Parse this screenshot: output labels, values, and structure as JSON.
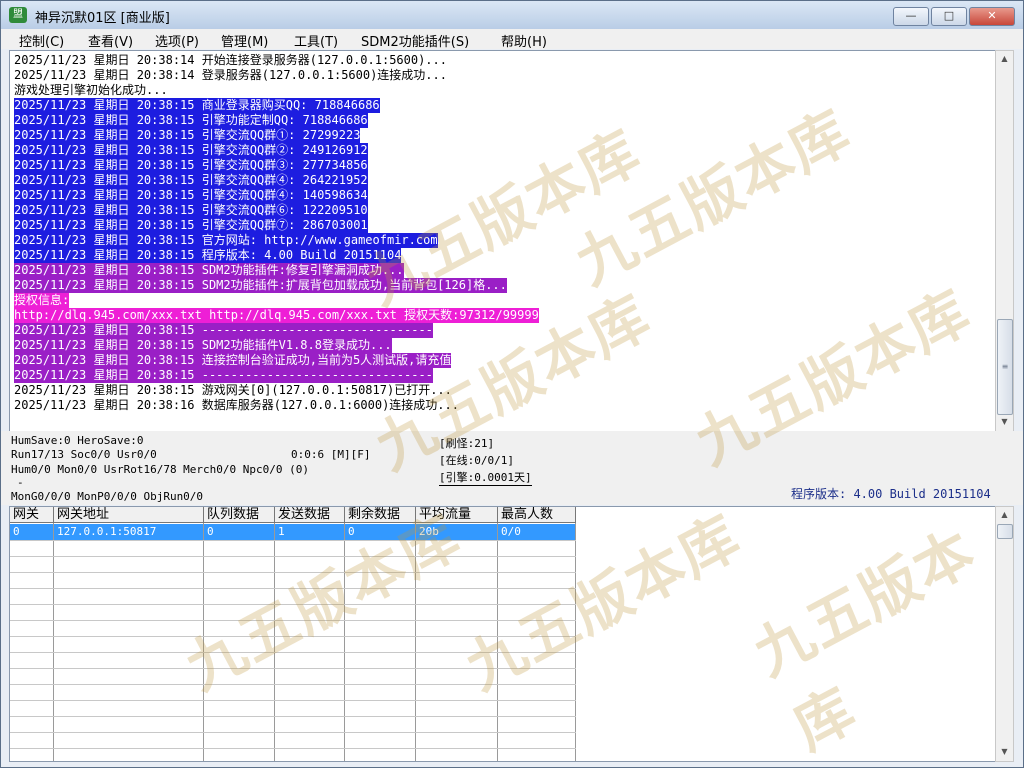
{
  "window": {
    "title": "神异沉默01区 [商业版]",
    "min": "—",
    "max": "□",
    "close": "✕",
    "icon": "app-icon"
  },
  "menu": [
    "控制(C)",
    "查看(V)",
    "选项(P)",
    "管理(M)",
    "工具(T)",
    "SDM2功能插件(S)",
    "帮助(H)"
  ],
  "log": [
    {
      "text": "2025/11/23 星期日 20:38:14 开始连接登录服务器(127.0.0.1:5600)...",
      "bg": "#ffffff",
      "fg": "#000000"
    },
    {
      "text": "2025/11/23 星期日 20:38:14 登录服务器(127.0.0.1:5600)连接成功...",
      "bg": "#ffffff",
      "fg": "#000000"
    },
    {
      "text": "游戏处理引擎初始化成功...",
      "bg": "#ffffff",
      "fg": "#000000"
    },
    {
      "text": "2025/11/23 星期日 20:38:15 商业登录器购买QQ: 718846686",
      "bg": "#1d1de0",
      "fg": "#ffffff"
    },
    {
      "text": "2025/11/23 星期日 20:38:15 引擎功能定制QQ: 718846686",
      "bg": "#1d1de0",
      "fg": "#ffffff"
    },
    {
      "text": "2025/11/23 星期日 20:38:15 引擎交流QQ群①: 27299223",
      "bg": "#1d1de0",
      "fg": "#ffffff"
    },
    {
      "text": "2025/11/23 星期日 20:38:15 引擎交流QQ群②: 249126912",
      "bg": "#1d1de0",
      "fg": "#ffffff"
    },
    {
      "text": "2025/11/23 星期日 20:38:15 引擎交流QQ群③: 277734856",
      "bg": "#1d1de0",
      "fg": "#ffffff"
    },
    {
      "text": "2025/11/23 星期日 20:38:15 引擎交流QQ群④: 264221952",
      "bg": "#1d1de0",
      "fg": "#ffffff"
    },
    {
      "text": "2025/11/23 星期日 20:38:15 引擎交流QQ群④: 140598634",
      "bg": "#1d1de0",
      "fg": "#ffffff"
    },
    {
      "text": "2025/11/23 星期日 20:38:15 引擎交流QQ群⑥: 122209510",
      "bg": "#1d1de0",
      "fg": "#ffffff"
    },
    {
      "text": "2025/11/23 星期日 20:38:15 引擎交流QQ群⑦: 286703001",
      "bg": "#1d1de0",
      "fg": "#ffffff"
    },
    {
      "text": "2025/11/23 星期日 20:38:15 官方网站: http://www.gameofmir.com",
      "bg": "#1d1de0",
      "fg": "#ffffff"
    },
    {
      "text": "2025/11/23 星期日 20:38:15 程序版本: 4.00 Build 20151104",
      "bg": "#1d1de0",
      "fg": "#ffffff"
    },
    {
      "text": "2025/11/23 星期日 20:38:15 SDM2功能插件:修复引擎漏洞成功...",
      "bg": "#9a1fc6",
      "fg": "#ffffff"
    },
    {
      "text": "2025/11/23 星期日 20:38:15 SDM2功能插件:扩展背包加载成功,当前背包[126]格...",
      "bg": "#9a1fc6",
      "fg": "#ffffff"
    },
    {
      "text": "授权信息:",
      "bg": "#ee1fd6",
      "fg": "#ffffff"
    },
    {
      "text": "http://dlq.945.com/xxx.txt http://dlq.945.com/xxx.txt 授权天数:97312/99999",
      "bg": "#ee1fd6",
      "fg": "#ffffff"
    },
    {
      "text": "2025/11/23 星期日 20:38:15 --------------------------------",
      "bg": "#9a1fc6",
      "fg": "#ffffff"
    },
    {
      "text": "2025/11/23 星期日 20:38:15 SDM2功能插件V1.8.8登录成功...",
      "bg": "#9a1fc6",
      "fg": "#ffffff"
    },
    {
      "text": "2025/11/23 星期日 20:38:15 连接控制台验证成功,当前为5人测试版,请充值",
      "bg": "#9a1fc6",
      "fg": "#ffffff"
    },
    {
      "text": "2025/11/23 星期日 20:38:15 --------------------------------",
      "bg": "#9a1fc6",
      "fg": "#ffffff"
    },
    {
      "text": "2025/11/23 星期日 20:38:15 游戏网关[0](127.0.0.1:50817)已打开...",
      "bg": "#ffffff",
      "fg": "#000000"
    },
    {
      "text": "2025/11/23 星期日 20:38:16 数据库服务器(127.0.0.1:6000)连接成功...",
      "bg": "#ffffff",
      "fg": "#000000"
    }
  ],
  "scroll": {
    "up": "▲",
    "down": "▼",
    "grip": "≡"
  },
  "status": {
    "save": "HumSave:0 HeroSave:0",
    "run": "Run17/13 Soc0/0 Usr0/0",
    "time": "0:0:6 [M][F]",
    "hum": "Hum0/0 Mon0/0 UsrRot16/78 Merch0/0 Npc0/0 (0)",
    "dash": "-",
    "mon": "MonG0/0/0 MonP0/0/0 ObjRun0/0",
    "refresh": "[刷怪:21]",
    "online": "[在线:0/0/1]",
    "engine": "[引擎:0.0001天]",
    "version": "程序版本: 4.00 Build 20151104"
  },
  "grid": {
    "columns": [
      "网关",
      "网关地址",
      "队列数据",
      "发送数据",
      "剩余数据",
      "平均流量",
      "最高人数"
    ],
    "rows": [
      [
        "0",
        "127.0.0.1:50817",
        "0",
        "1",
        "0",
        "20b",
        "0/0"
      ]
    ],
    "selected_color": "#3399ff"
  },
  "watermark": "九五版本库"
}
